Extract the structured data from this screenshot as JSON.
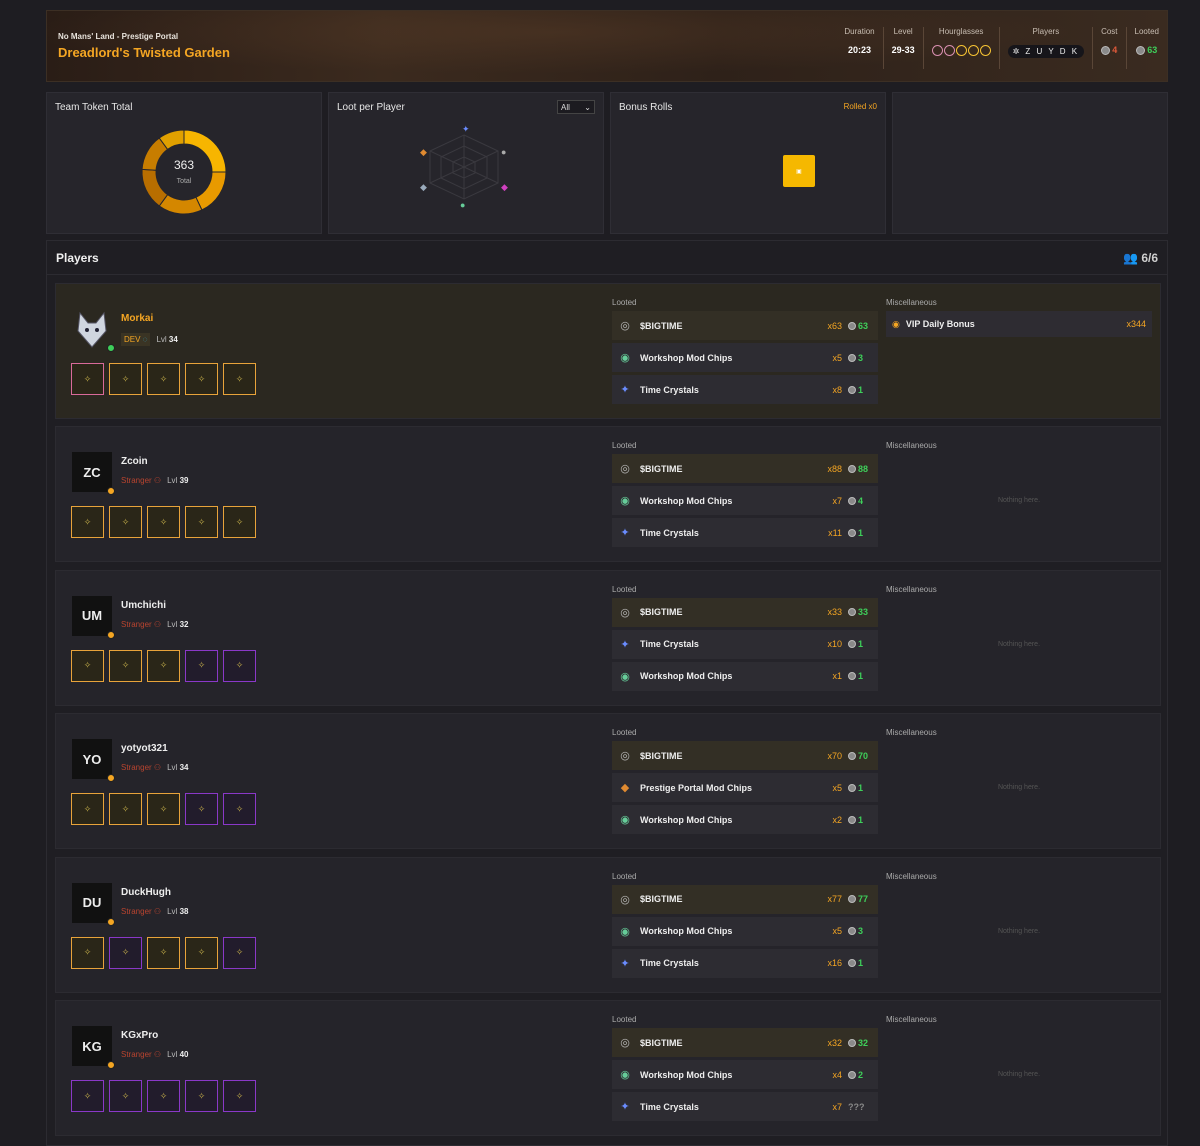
{
  "header": {
    "subtitle": "No Mans' Land - Prestige Portal",
    "title": "Dreadlord's Twisted Garden",
    "stats": {
      "duration_label": "Duration",
      "duration": "20:23",
      "level_label": "Level",
      "level": "29-33",
      "hourglasses_label": "Hourglasses",
      "players_label": "Players",
      "players_letters": "Z U Y D K",
      "cost_label": "Cost",
      "cost": "4",
      "looted_label": "Looted",
      "looted": "63"
    }
  },
  "cards": {
    "team_token": "Team Token Total",
    "total": "363",
    "total_label": "Total",
    "loot_per_player": "Loot per Player",
    "filter": "All",
    "bonus_rolls": "Bonus Rolls",
    "rolled": "Rolled x0"
  },
  "team_token_share": [
    0.25,
    0.18,
    0.17,
    0.16,
    0.14,
    0.1
  ],
  "players": {
    "title": "Players",
    "count": "6/6",
    "looted_label": "Looted",
    "misc_label": "Miscellaneous",
    "nothing": "Nothing here.",
    "rows": [
      {
        "initials": "",
        "name": "Morkai",
        "tag": "DEV",
        "lvl_label": "Lvl",
        "lvl": "34",
        "slots": [
          "pk",
          "g",
          "g",
          "g",
          "g"
        ],
        "loot": [
          {
            "name": "$BIGTIME",
            "qty": "x63",
            "tok": "63"
          },
          {
            "name": "Workshop Mod Chips",
            "qty": "x5",
            "tok": "3"
          },
          {
            "name": "Time Crystals",
            "qty": "x8",
            "tok": "1"
          }
        ],
        "misc": {
          "name": "VIP Daily Bonus",
          "qty": "x344"
        }
      },
      {
        "initials": "ZC",
        "name": "Zcoin",
        "tag": "Stranger",
        "lvl_label": "Lvl",
        "lvl": "39",
        "slots": [
          "g",
          "g",
          "g",
          "g",
          "g"
        ],
        "loot": [
          {
            "name": "$BIGTIME",
            "qty": "x88",
            "tok": "88"
          },
          {
            "name": "Workshop Mod Chips",
            "qty": "x7",
            "tok": "4"
          },
          {
            "name": "Time Crystals",
            "qty": "x11",
            "tok": "1"
          }
        ]
      },
      {
        "initials": "UM",
        "name": "Umchichi",
        "tag": "Stranger",
        "lvl_label": "Lvl",
        "lvl": "32",
        "slots": [
          "g",
          "g",
          "g",
          "p",
          "p"
        ],
        "loot": [
          {
            "name": "$BIGTIME",
            "qty": "x33",
            "tok": "33"
          },
          {
            "name": "Time Crystals",
            "qty": "x10",
            "tok": "1"
          },
          {
            "name": "Workshop Mod Chips",
            "qty": "x1",
            "tok": "1"
          }
        ]
      },
      {
        "initials": "YO",
        "name": "yotyot321",
        "tag": "Stranger",
        "lvl_label": "Lvl",
        "lvl": "34",
        "slots": [
          "g",
          "g",
          "g",
          "p",
          "p"
        ],
        "loot": [
          {
            "name": "$BIGTIME",
            "qty": "x70",
            "tok": "70"
          },
          {
            "name": "Prestige Portal Mod Chips",
            "qty": "x5",
            "tok": "1"
          },
          {
            "name": "Workshop Mod Chips",
            "qty": "x2",
            "tok": "1"
          }
        ]
      },
      {
        "initials": "DU",
        "name": "DuckHugh",
        "tag": "Stranger",
        "lvl_label": "Lvl",
        "lvl": "38",
        "slots": [
          "g",
          "p",
          "g",
          "g",
          "p"
        ],
        "loot": [
          {
            "name": "$BIGTIME",
            "qty": "x77",
            "tok": "77"
          },
          {
            "name": "Workshop Mod Chips",
            "qty": "x5",
            "tok": "3"
          },
          {
            "name": "Time Crystals",
            "qty": "x16",
            "tok": "1"
          }
        ]
      },
      {
        "initials": "KG",
        "name": "KGxPro",
        "tag": "Stranger",
        "lvl_label": "Lvl",
        "lvl": "40",
        "slots": [
          "p",
          "p",
          "p",
          "p",
          "p"
        ],
        "loot": [
          {
            "name": "$BIGTIME",
            "qty": "x32",
            "tok": "32"
          },
          {
            "name": "Workshop Mod Chips",
            "qty": "x4",
            "tok": "2"
          },
          {
            "name": "Time Crystals",
            "qty": "x7",
            "tok": "???"
          }
        ]
      }
    ]
  }
}
